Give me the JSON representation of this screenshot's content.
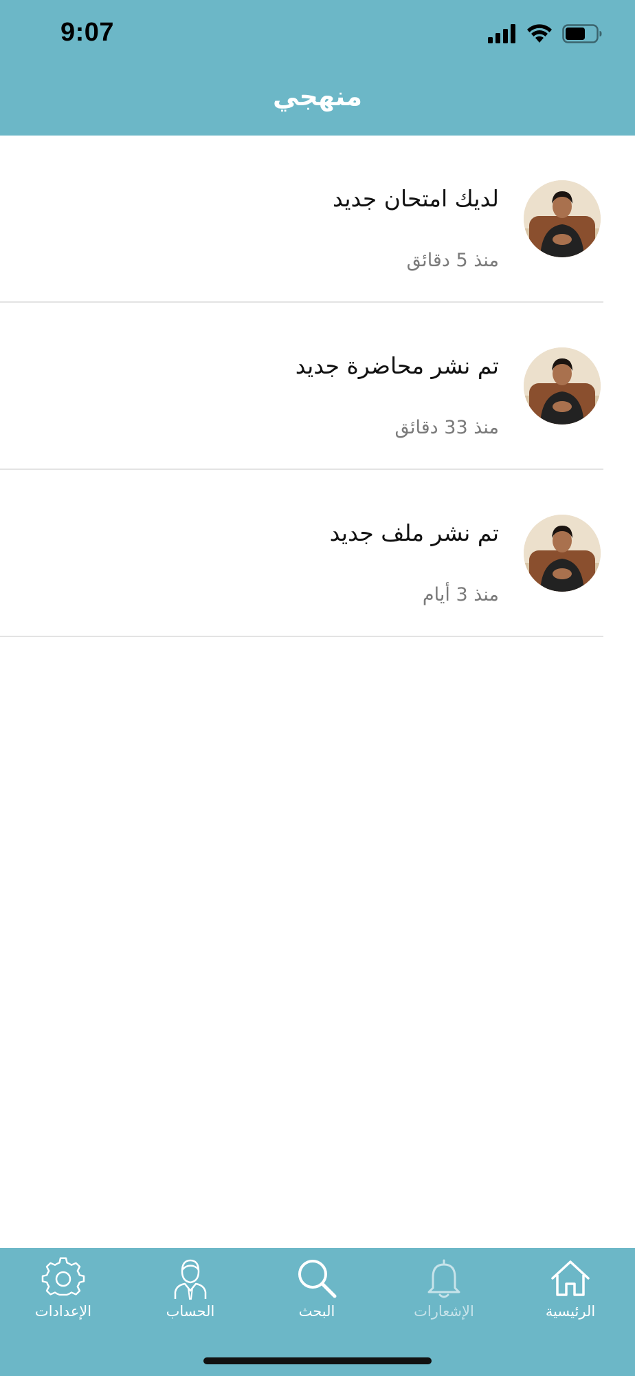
{
  "status_bar": {
    "time": "9:07",
    "icons": [
      "signal-icon",
      "wifi-icon",
      "battery-icon"
    ]
  },
  "header": {
    "title": "منهجي",
    "background_color": "#6cb7c7"
  },
  "notifications": [
    {
      "text": "لديك امتحان جديد",
      "time": "منذ 5 دقائق",
      "avatar": "avatar-photo"
    },
    {
      "text": "تم نشر محاضرة جديد",
      "time": "منذ 33 دقائق",
      "avatar": "avatar-photo"
    },
    {
      "text": "تم نشر ملف جديد",
      "time": "منذ 3 أيام",
      "avatar": "avatar-photo"
    }
  ],
  "tabbar": {
    "background_color": "#6cb7c7",
    "tabs": [
      {
        "label": "الرئيسية",
        "icon": "home-icon",
        "active": true
      },
      {
        "label": "الإشعارات",
        "icon": "bell-icon",
        "active": false
      },
      {
        "label": "البحث",
        "icon": "search-icon",
        "active": true
      },
      {
        "label": "الحساب",
        "icon": "account-icon",
        "active": true
      },
      {
        "label": "الإعدادات",
        "icon": "gear-icon",
        "active": true
      }
    ]
  }
}
